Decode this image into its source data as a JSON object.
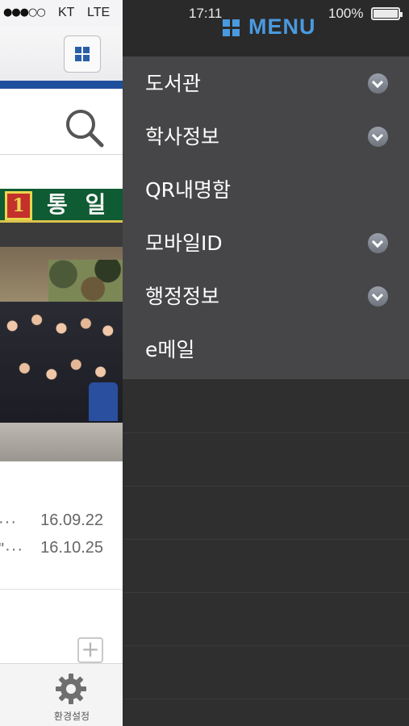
{
  "status_bar": {
    "signal": "●●●○○",
    "carrier": "KT",
    "network": "LTE",
    "time": "17:11",
    "battery_percent": "100%"
  },
  "menu": {
    "title": "MENU",
    "accent_color": "#4a9ae0",
    "items": [
      {
        "label": "도서관",
        "has_submenu": true
      },
      {
        "label": "학사정보",
        "has_submenu": true
      },
      {
        "label": "QR내명함",
        "has_submenu": false
      },
      {
        "label": "모바일ID",
        "has_submenu": true
      },
      {
        "label": "행정정보",
        "has_submenu": true
      },
      {
        "label": "e메일",
        "has_submenu": false
      }
    ]
  },
  "app": {
    "header_button_icon": "grid-icon",
    "search_icon": "search-icon",
    "photo_sign_text": "통 일",
    "photo_badge_text": "1",
    "news": [
      {
        "title": "···",
        "date": "16.09.22"
      },
      {
        "title": "\"···",
        "date": "16.10.25"
      }
    ],
    "more_button": "+",
    "tab_bar": {
      "settings_label": "환경설정",
      "settings_icon": "gear-icon"
    }
  }
}
